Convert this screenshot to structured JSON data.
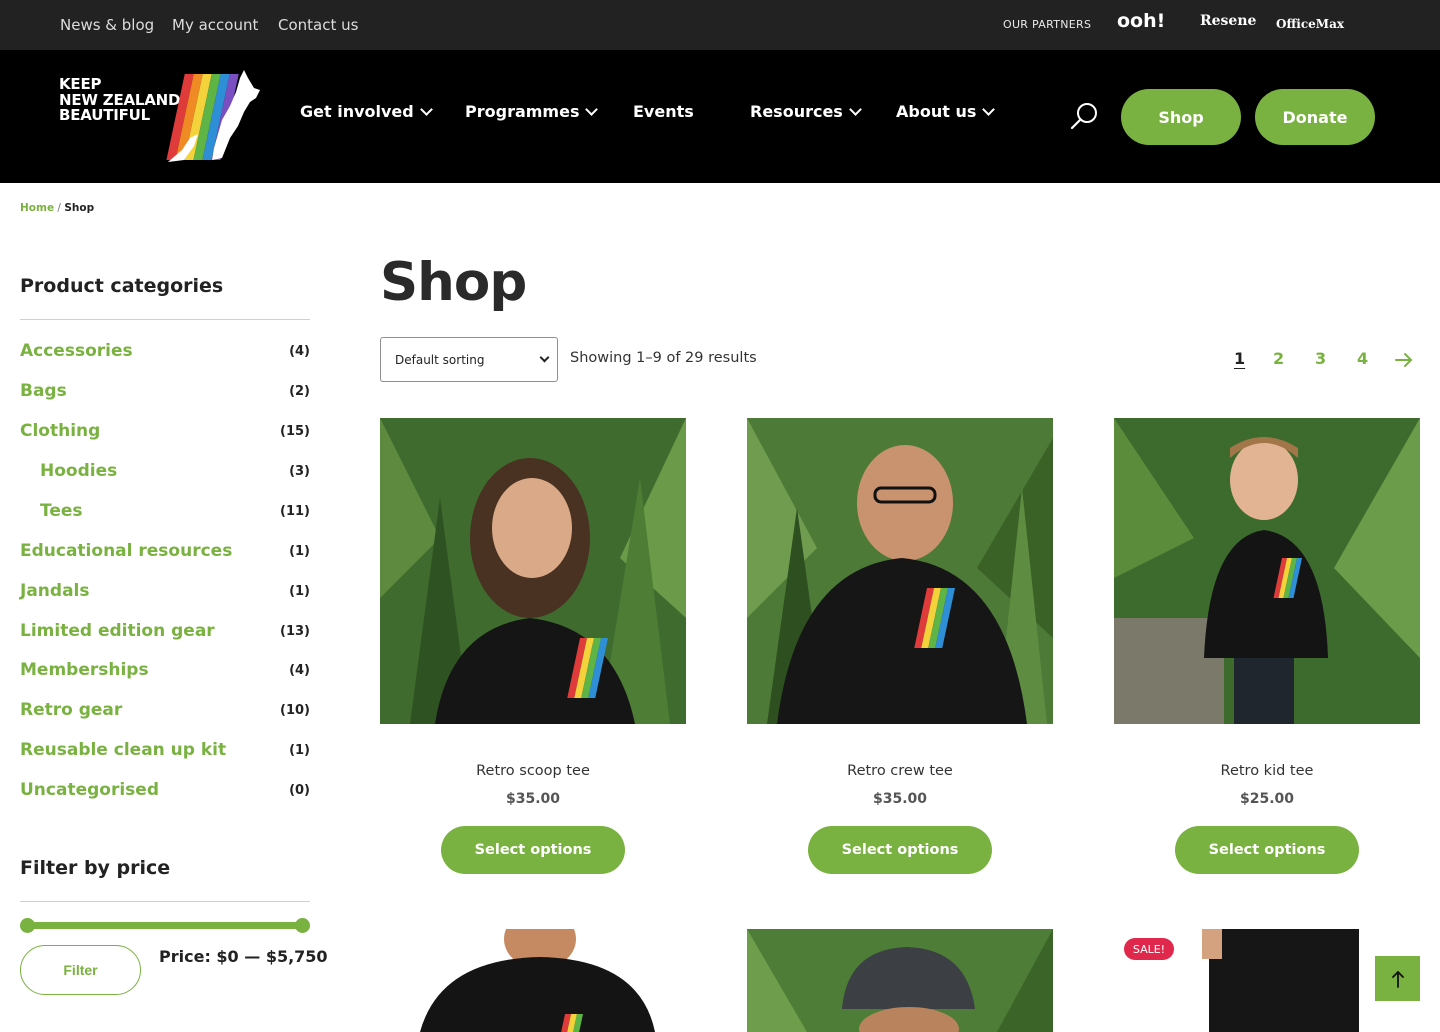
{
  "topbar": {
    "links": [
      "News & blog",
      "My account",
      "Contact us"
    ],
    "partners_label": "OUR PARTNERS",
    "partners": [
      "ooh!",
      "Resene",
      "OfficeMax"
    ]
  },
  "header": {
    "logo_lines": [
      "KEEP",
      "NEW ZEALAND",
      "BEAUTIFUL"
    ],
    "nav": [
      "Get involved",
      "Programmes",
      "Events",
      "Resources",
      "About us"
    ],
    "shop_label": "Shop",
    "donate_label": "Donate"
  },
  "breadcrumb": {
    "home": "Home",
    "separator": "/",
    "current": "Shop"
  },
  "sidebar": {
    "categories_heading": "Product categories",
    "categories": [
      {
        "name": "Accessories",
        "count": "(4)"
      },
      {
        "name": "Bags",
        "count": "(2)"
      },
      {
        "name": "Clothing",
        "count": "(15)"
      },
      {
        "name": "Hoodies",
        "count": "(3)"
      },
      {
        "name": "Tees",
        "count": "(11)"
      },
      {
        "name": "Educational resources",
        "count": "(1)"
      },
      {
        "name": "Jandals",
        "count": "(1)"
      },
      {
        "name": "Limited edition gear",
        "count": "(13)"
      },
      {
        "name": "Memberships",
        "count": "(4)"
      },
      {
        "name": "Retro gear",
        "count": "(10)"
      },
      {
        "name": "Reusable clean up kit",
        "count": "(1)"
      },
      {
        "name": "Uncategorised",
        "count": "(0)"
      }
    ],
    "filter_heading": "Filter by price",
    "filter_button": "Filter",
    "price_label": "Price: $0 — $5,750"
  },
  "main": {
    "title": "Shop",
    "sort_selected": "Default sorting",
    "result_count": "Showing 1–9 of 29 results",
    "pages": [
      "1",
      "2",
      "3",
      "4"
    ],
    "products": [
      {
        "name": "Retro scoop tee",
        "price": "$35.00",
        "button": "Select options"
      },
      {
        "name": "Retro crew tee",
        "price": "$35.00",
        "button": "Select options"
      },
      {
        "name": "Retro kid tee",
        "price": "$25.00",
        "button": "Select options"
      }
    ],
    "sale_badge": "SALE!"
  },
  "colors": {
    "accent_green": "#7ab241",
    "header_black": "#000000",
    "topbar": "#222222",
    "sale_red": "#e0284d"
  },
  "icons": [
    "search-icon",
    "chevron-down-icon",
    "arrow-right-icon",
    "arrow-up-icon",
    "nz-map-logo-icon"
  ]
}
